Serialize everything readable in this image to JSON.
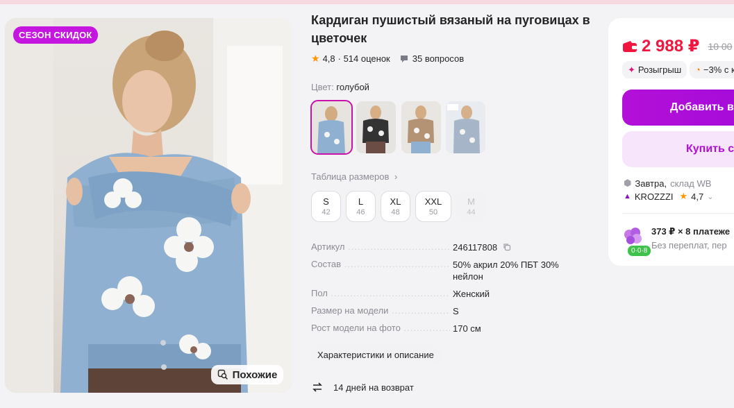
{
  "image": {
    "badge": "СЕЗОН СКИДОК",
    "similar_label": "Похожие"
  },
  "product": {
    "title": "Кардиган пушистый вязаный на пуговицах в цветочек",
    "rating": "4,8",
    "reviews": "· 514 оценок",
    "questions": "35 вопросов",
    "color_label": "Цвет:",
    "color_value": "голубой",
    "size_table_label": "Таблица размеров",
    "sizes": [
      {
        "name": "S",
        "ru": "42",
        "available": true
      },
      {
        "name": "L",
        "ru": "46",
        "available": true
      },
      {
        "name": "XL",
        "ru": "48",
        "available": true
      },
      {
        "name": "XXL",
        "ru": "50",
        "available": true
      },
      {
        "name": "M",
        "ru": "44",
        "available": false
      }
    ],
    "specs": [
      {
        "key": "Артикул",
        "value": "246117808"
      },
      {
        "key": "Состав",
        "value": "50% акрил 20% ПБТ 30% нейлон"
      },
      {
        "key": "Пол",
        "value": "Женский"
      },
      {
        "key": "Размер на модели",
        "value": "S"
      },
      {
        "key": "Рост модели на фото",
        "value": "170 см"
      }
    ],
    "characteristics_button": "Характеристики и описание",
    "return_policy": "14 дней на возврат"
  },
  "buy_card": {
    "price": "2 988 ₽",
    "old_price": "10 00",
    "chip_lottery": "Розыгрыш",
    "chip_discount": "−3% с к",
    "add_button": "Добавить в",
    "buy_button": "Купить с",
    "delivery_day": "Завтра,",
    "delivery_place": "склад WB",
    "seller_name": "KROZZZI",
    "seller_rating": "4,7",
    "installment_title": "373 ₽ × 8 платеже",
    "installment_sub": "Без переплат, пер",
    "installment_badge": "0·0·8"
  },
  "colors": {
    "accent": "#cb11ab",
    "price": "#f0163f",
    "primary_button": "#a50bd9",
    "sale_badge": "#c516e0"
  }
}
